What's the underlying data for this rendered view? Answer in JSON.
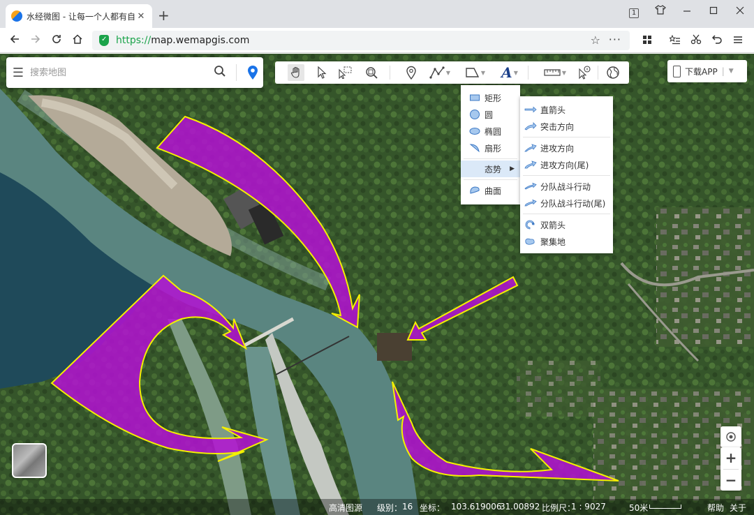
{
  "browser": {
    "tab_title": "水经微图 - 让每一个人都有自",
    "tab_close": "✕",
    "new_tab": "+",
    "tab_count": "1",
    "url_scheme": "https://",
    "url_host": "map.wemapgis.com"
  },
  "search": {
    "placeholder": "搜索地图"
  },
  "download": {
    "label": "下载APP",
    "divider": "|"
  },
  "shape_menu": {
    "items": [
      {
        "label": "矩形",
        "icon": "rectangle-icon"
      },
      {
        "label": "圆",
        "icon": "circle-icon"
      },
      {
        "label": "椭圆",
        "icon": "ellipse-icon"
      },
      {
        "label": "扇形",
        "icon": "sector-icon"
      },
      {
        "label": "态势",
        "icon": "situation-icon",
        "selected": true
      },
      {
        "label": "曲面",
        "icon": "curved-surface-icon"
      }
    ]
  },
  "situation_menu": {
    "items": [
      {
        "label": "直箭头"
      },
      {
        "label": "突击方向"
      },
      {
        "label": "进攻方向"
      },
      {
        "label": "进攻方向(尾)"
      },
      {
        "label": "分队战斗行动"
      },
      {
        "label": "分队战斗行动(尾)"
      },
      {
        "label": "双箭头"
      },
      {
        "label": "聚集地"
      }
    ]
  },
  "status": {
    "imagery": "高清图源",
    "level_label": "级别：",
    "level": "16",
    "coord_label": "坐标：",
    "lon": "103.619006",
    "lat": "31.00892",
    "scale_label": "比例尺：",
    "scale": "1 : 9027",
    "scale_bar": "50米",
    "help": "帮助",
    "about": "关于"
  },
  "colors": {
    "plot_fill": "#b412d4",
    "plot_stroke": "#f4f000",
    "accent": "#1a73e8",
    "secure": "#1aa34a"
  }
}
